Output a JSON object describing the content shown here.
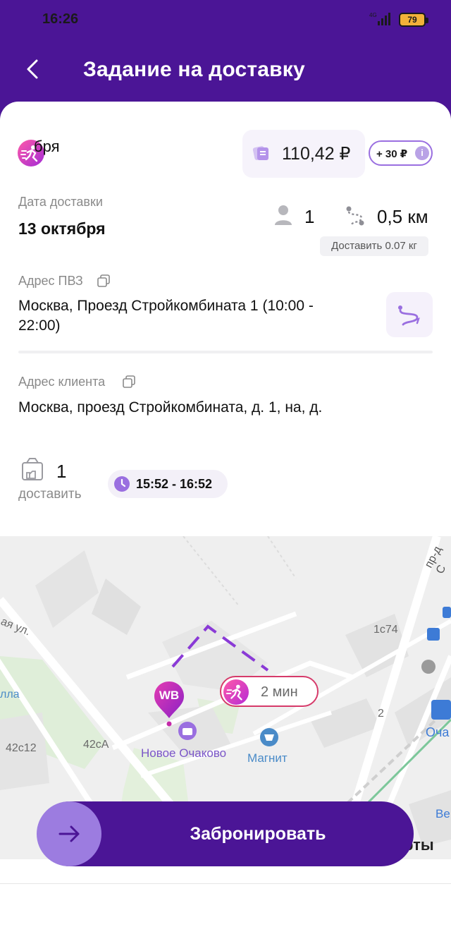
{
  "status_bar": {
    "time": "16:26",
    "network": "4G",
    "battery": "79"
  },
  "header": {
    "title": "Задание на доставку",
    "back_icon": "chevron-left-icon"
  },
  "summary": {
    "courier_month_partial": "бря",
    "price": "110,42 ₽",
    "bonus": "+ 30 ₽",
    "bonus_info_icon": "info-icon"
  },
  "delivery": {
    "date_label": "Дата доставки",
    "date_value": "13 октября",
    "persons": "1",
    "distance": "0,5 км",
    "weight": "Доставить 0.07 кг"
  },
  "pickup": {
    "label": "Адрес ПВЗ",
    "address_line1": "Москва, Проезд Стройкомбината 1 (10:00 -",
    "address_line2": "22:00)"
  },
  "client": {
    "label": "Адрес клиента",
    "address": "Москва, проезд Стройкомбината, д. 1, на, д."
  },
  "parcels": {
    "count": "1",
    "label": "доставить",
    "time_window": "15:52 - 16:52"
  },
  "map": {
    "eta": "2 мин",
    "pickup_pin": "WB",
    "labels": {
      "street_left": "ая ул.",
      "poi_left": "лла",
      "house_42c12": "42с12",
      "house_42ca": "42сА",
      "poi_novoe": "Новое Очаково",
      "poi_magnit": "Магнит",
      "house_1c74": "1с74",
      "house_2": "2",
      "road_right": "пр-д С",
      "metro_label": "Оча",
      "poi_right_ve": "Ве",
      "poi_right_rty": "рты"
    }
  },
  "actions": {
    "book_label": "Забронировать"
  },
  "colors": {
    "brand_purple": "#4b1596",
    "accent_light": "#9c7ce0",
    "pink": "#d63a6a"
  }
}
